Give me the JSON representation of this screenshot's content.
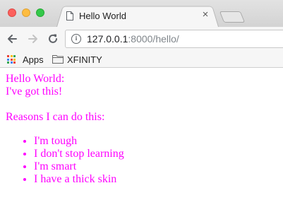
{
  "browser": {
    "tab_title": "Hello World",
    "url_host": "127.0.0.1",
    "url_rest": ":8000/hello/",
    "bookmarks": [
      {
        "label": "Apps",
        "icon": "apps-grid-icon"
      },
      {
        "label": "XFINITY",
        "icon": "folder-icon"
      }
    ]
  },
  "page": {
    "line1": "Hello World:",
    "line2": "I've got this!",
    "line3": "Reasons I can do this:",
    "reasons": [
      "I'm tough",
      "I don't stop learning",
      "I'm smart",
      "I have a thick skin"
    ],
    "text_color": "#ff00ff"
  }
}
